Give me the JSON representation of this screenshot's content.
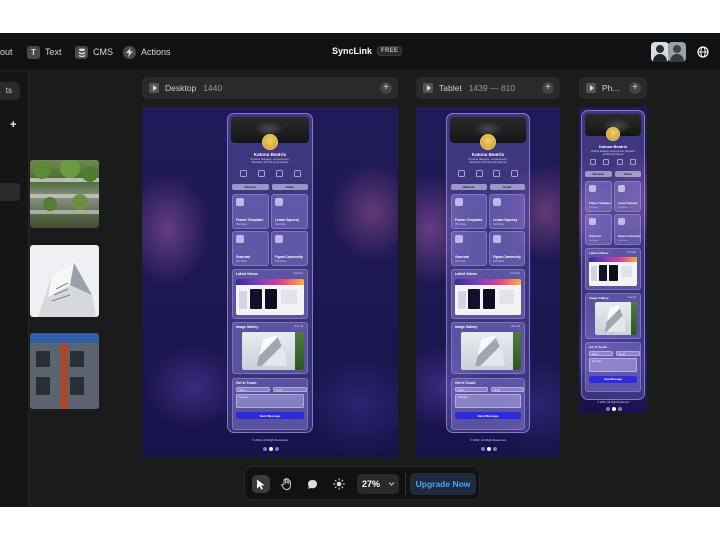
{
  "topbar": {
    "left_items": [
      {
        "label": "out",
        "icon": "layout-icon"
      },
      {
        "label": "Text",
        "icon": "text-icon",
        "glyph": "T"
      },
      {
        "label": "CMS",
        "icon": "database-icon"
      },
      {
        "label": "Actions",
        "icon": "bolt-icon"
      }
    ],
    "app_title": "SyncLink",
    "plan_badge": "FREE"
  },
  "left_panel": {
    "tab_label": "ts"
  },
  "frames": [
    {
      "label": "Desktop",
      "dims": "1440"
    },
    {
      "label": "Tablet",
      "dims": "1439 — 810"
    },
    {
      "label": "Ph..."
    }
  ],
  "profile": {
    "name": "Katona Beatrix",
    "bio": "Product designer, entrepreneur, illustrator and life-long learner",
    "buttons": [
      "Website",
      "Email"
    ],
    "cards": [
      {
        "title": "Framer Templates",
        "sub": "Visit Store"
      },
      {
        "title": "Lemon Squeezy",
        "sub": "Visit Store"
      },
      {
        "title": "Gumroad",
        "sub": "Visit Store"
      },
      {
        "title": "Figma Community",
        "sub": "Visit Store"
      }
    ],
    "videos_title": "Latest Videos",
    "videos_link": "YouTube",
    "gallery_title": "Image Gallery",
    "gallery_link": "View All",
    "contact_title": "Get In Touch",
    "contact_fields": [
      "Name",
      "Email",
      "Message"
    ],
    "send_label": "Send Message",
    "copyright": "© 2022, All Right Reserved"
  },
  "toolbar": {
    "zoom": "27%",
    "upgrade_label": "Upgrade Now"
  },
  "colors": {
    "accent": "#4aa3ff",
    "send_button": "#2b2bdc",
    "canvas_bg": "#1b1b1b"
  }
}
